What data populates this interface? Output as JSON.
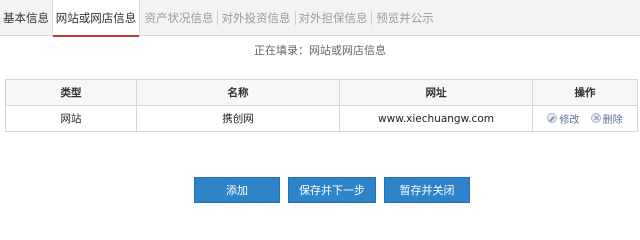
{
  "tabs": [
    {
      "label": "基本信息"
    },
    {
      "label": "网站或网店信息"
    },
    {
      "label": "资产状况信息"
    },
    {
      "label": "对外投资信息"
    },
    {
      "label": "对外担保信息"
    },
    {
      "label": "预览并公示"
    }
  ],
  "status": {
    "filling_label": "正在填录：网站或网店信息"
  },
  "table": {
    "headers": [
      "类型",
      "名称",
      "网址",
      "操作"
    ],
    "rows": [
      {
        "type": "网站",
        "name": "携创网",
        "url": "www.xiechuangw.com",
        "edit": "修改",
        "delete": "删除"
      }
    ]
  },
  "buttons": {
    "add": "添加",
    "save_next": "保存并下一步",
    "save_close": "暂存并关闭"
  },
  "colors": {
    "accent_underline": "#c0392b",
    "button_blue": "#2f83c8"
  }
}
